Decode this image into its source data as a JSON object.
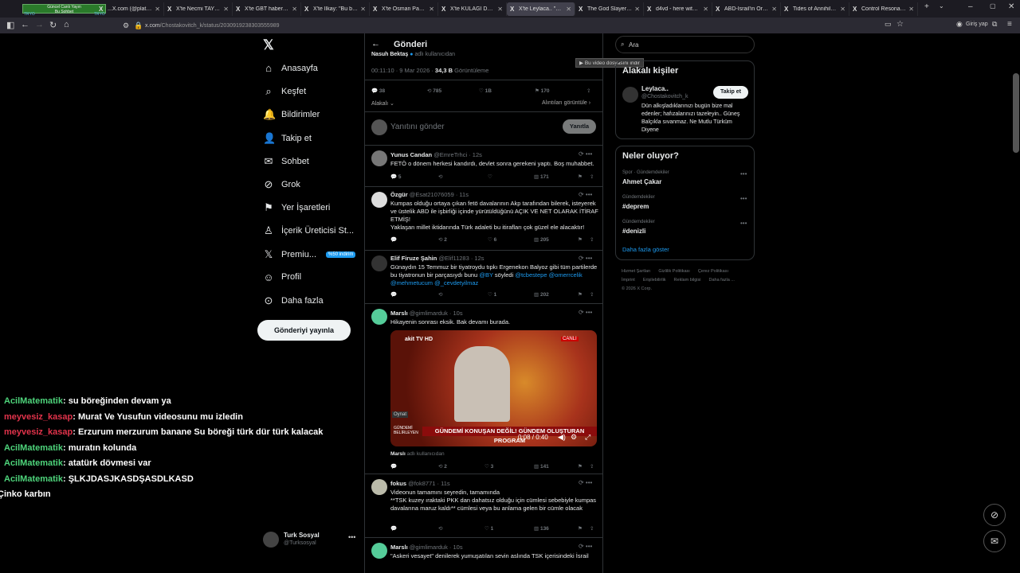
{
  "browser": {
    "overlay_line1": "Güncel Canlı Yayın",
    "overlay_line2": "Bu Sohbet",
    "overlay_tr": "TRYO",
    "tabs": [
      {
        "label": "...X.com (@platcomi..."
      },
      {
        "label": "X'te Necmi TAYIN: \"…"
      },
      {
        "label": "X'te GBT haberi: \"Erkek…"
      },
      {
        "label": "X'te İlkay: \"Bu bizim…"
      },
      {
        "label": "X'te Osman Pamukoğ…"
      },
      {
        "label": "X'te KULAĞI DELİK HA…"
      },
      {
        "label": "X'te Leylaca.. \"Mi…",
        "active": true
      },
      {
        "label": "The God Slayer - Gam…"
      },
      {
        "label": "d4vd - here with me |…"
      },
      {
        "label": "ABD-İsrail'in Ortadoğ…"
      },
      {
        "label": "Tides of Annihilation"
      },
      {
        "label": "Control Resonant - G…"
      }
    ],
    "url_host": "x.com",
    "url_path": "/Chostakovitch_k/status/2030919238303555989",
    "signin": "Giriş yap",
    "download_tip": "Bu video dosyasını indir"
  },
  "nav": {
    "items": [
      "Anasayfa",
      "Keşfet",
      "Bildirimler",
      "Takip et",
      "Sohbet",
      "Grok",
      "Yer İşaretleri",
      "İçerik Üreticisi St...",
      "Premiu...",
      "Profil",
      "Daha fazla"
    ],
    "premium_badge": "%50 indirim",
    "post_button": "Gönderiyi yayınla",
    "account_name": "Turk Sosyal",
    "account_handle": "@Turksosyal"
  },
  "header": {
    "title": "Gönderi"
  },
  "post": {
    "author": "Nasuh Bektaş",
    "author_note": "adlı kullanıcıdan",
    "time": "00:11:10 · 9 Mar 2026 ·",
    "views": "34,3 B",
    "views_label": "Görüntüleme",
    "replies": "38",
    "reposts": "785",
    "likes": "1B",
    "bookmarks": "170",
    "sort": "Alakalı",
    "quotes": "Alıntıları görüntüle",
    "reply_placeholder": "Yanıtını gönder",
    "reply_button": "Yanıtla"
  },
  "replies": [
    {
      "name": "Yunus Candan",
      "handle": "@EmreTrhci · 12s",
      "text": "FETÖ o dönem herkesi kandırdı, devlet sonra gerekeni yaptı. Boş muhabbet.",
      "reply": "5",
      "repost": "",
      "like": "",
      "views": "171"
    },
    {
      "name": "Özgür",
      "handle": "@Esat21076059 · 11s",
      "text": "Kumpas olduğu ortaya çıkan fetö davalarının Akp tarafından bilerek, isteyerek ve üstelik ABD ile işbirliği içinde yürütüldüğünü AÇIK VE NET OLARAK İTİRAF ETMİŞ!",
      "text2": "Yaklaşan millet iktidarında Türk adaleti bu itirafları çok güzel ele alacaktır!",
      "reply": "",
      "repost": "2",
      "like": "6",
      "views": "205"
    },
    {
      "name": "Elif Firuze Şahin",
      "handle": "@Elif11283 · 12s",
      "text": "Günaydın 15 Temmuz bir tiyatroydu tıpkı Ergenekon Balyoz gibi tüm partilerde bu tiyatronun bir parçasıydı bunu",
      "mention1": "@BY",
      "text_mid": "söyledi",
      "mention2": "@tcbestepe",
      "mention3": "@omerrcelik @mehmetucum @_cevdetyilmaz",
      "reply": "",
      "repost": "",
      "like": "1",
      "views": "202"
    },
    {
      "name": "Marslı",
      "handle": "@gimlimarduk · 10s",
      "text": "Hikayenin sonrası eksik. Bak devamı burada.",
      "video_time": "0:08 / 0:40",
      "video_banner": "GÜNDEMİ KONUŞAN DEĞİL! GÜNDEM OLUŞTURAN PROGRAM",
      "video_channel": "akit TV HD",
      "video_live": "CANLI",
      "video_play": "Oynat",
      "video_small": "GÜNDEMİ BELİRLEYEN",
      "credit_name": "Marslı",
      "credit_suffix": "adlı kullanıcıdan",
      "reply": "",
      "repost": "2",
      "like": "3",
      "views": "141"
    },
    {
      "name": "fokus",
      "handle": "@fok8771 · 11s",
      "text": "Videonun tamamını seyredin, tamamında",
      "text2": "**TSK kuzey ıraktaki PKK dan dahatsız olduğu için cümlesi sebebiyle kumpas davalarına maruz kaldı** cümlesi veya bu anlama gelen bir cümle olacak",
      "reply": "",
      "repost": "",
      "like": "1",
      "views": "136"
    },
    {
      "name": "Marslı",
      "handle": "@gimlimarduk · 10s",
      "text": "\"Askeri vesayet\" denilerek yumuşatılan sevin aslında TSK içerisindeki İsrail"
    }
  ],
  "right": {
    "search_placeholder": "Ara",
    "related_title": "Alakalı kişiler",
    "person_name": "Leylaca..",
    "person_handle": "@Chostakovitch_k",
    "follow": "Takip et",
    "bio": "Dün alkışladıklarınızı bugün bize mal edenler; hafızalarınızı tazeleyin.. Güneş Balçıkla sıvanmaz. Ne Mutlu Türküm Diyene",
    "trends_title": "Neler oluyor?",
    "trends": [
      {
        "cat": "Spor · Gündemdekiler",
        "name": "Ahmet Çakar"
      },
      {
        "cat": "Gündemdekiler",
        "name": "#deprem"
      },
      {
        "cat": "Gündemdekiler",
        "name": "#denizli"
      }
    ],
    "show_more": "Daha fazla göster",
    "footer": [
      "Hizmet Şartları",
      "Gizlilik Politikası",
      "Çerez Politikası",
      "İmprint",
      "Erişilebilirlik",
      "Reklam bilgisi",
      "Daha fazla ...",
      "© 2026 X Corp."
    ]
  },
  "chat": [
    {
      "user": "AcilMatematik",
      "color": "green",
      "msg": ": su böreğinden devam ya"
    },
    {
      "user": "meyvesiz_kasap",
      "color": "red",
      "msg": ": Murat Ve Yusufun videosunu mu izledin"
    },
    {
      "user": "meyvesiz_kasap",
      "color": "red",
      "msg": ": Erzurum merzurum banane Su böreği türk dür türk kalacak"
    },
    {
      "user": "AcilMatematik",
      "color": "green",
      "msg": ": muratın kolunda"
    },
    {
      "user": "AcilMatematik",
      "color": "green",
      "msg": ": atatürk dövmesi var"
    },
    {
      "user": "AcilMatematik",
      "color": "green",
      "msg": ": ŞLKJDASJKASDŞASDLKASD"
    },
    {
      "user": "",
      "color": "white",
      "msg": "Çinko karbın"
    }
  ]
}
